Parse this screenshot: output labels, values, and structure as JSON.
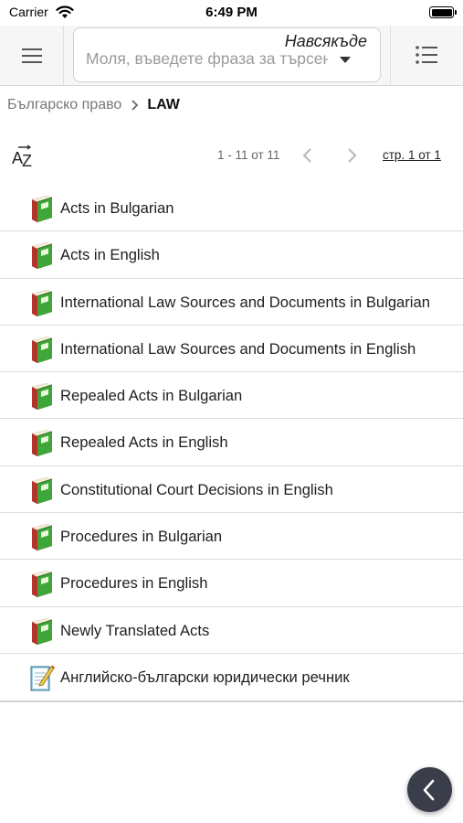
{
  "status_bar": {
    "carrier": "Carrier",
    "time": "6:49 PM"
  },
  "toolbar": {
    "menu_icon": "hamburger-icon",
    "search": {
      "scope_label": "Навсякъде",
      "placeholder": "Моля, въведете фраза за търсене",
      "value": ""
    },
    "list_icon": "list-icon"
  },
  "breadcrumb": {
    "root": "Българско право",
    "current": "LAW"
  },
  "pager": {
    "sort_icon": "az-sort-icon",
    "range": "1 - 11 от 11",
    "page_link": "стр. 1 от 1"
  },
  "items": [
    {
      "label": "Acts in Bulgarian",
      "icon": "book-icon"
    },
    {
      "label": "Acts in English",
      "icon": "book-icon"
    },
    {
      "label": "International Law Sources and Documents in Bulgarian",
      "icon": "book-icon"
    },
    {
      "label": "International Law Sources and Documents in English",
      "icon": "book-icon"
    },
    {
      "label": "Repealed Acts in Bulgarian",
      "icon": "book-icon"
    },
    {
      "label": "Repealed Acts in English",
      "icon": "book-icon"
    },
    {
      "label": "Constitutional Court Decisions in English",
      "icon": "book-icon"
    },
    {
      "label": "Procedures in Bulgarian",
      "icon": "book-icon"
    },
    {
      "label": "Procedures in English",
      "icon": "book-icon"
    },
    {
      "label": "Newly Translated Acts",
      "icon": "book-icon"
    },
    {
      "label": "Английско-български юридически речник",
      "icon": "notepad-icon"
    }
  ],
  "colors": {
    "book_green": "#3fa63a",
    "book_red": "#b3342a",
    "fab_bg": "#3a3d4a"
  }
}
